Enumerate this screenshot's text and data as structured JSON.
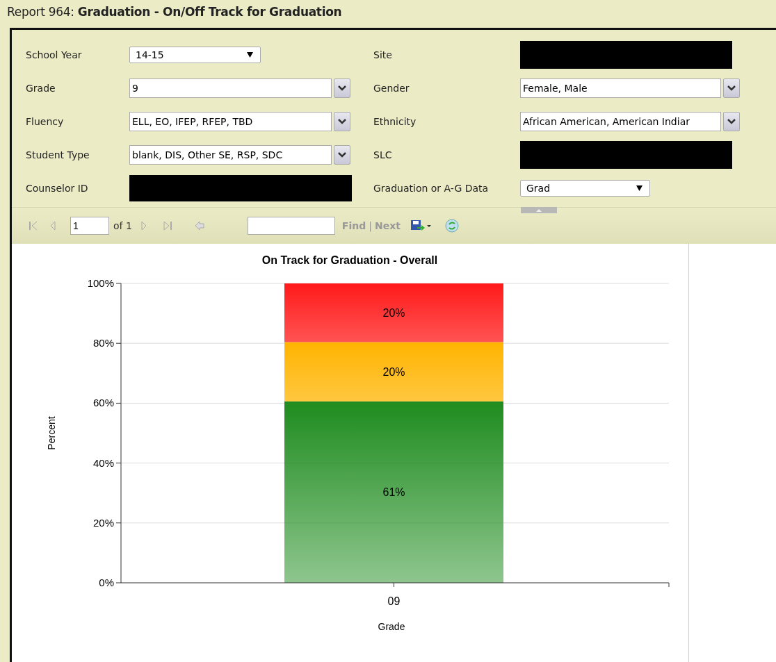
{
  "report_title": {
    "prefix": "Report 964:",
    "name": "Graduation - On/Off Track for Graduation"
  },
  "parameters": {
    "left": [
      {
        "label": "School Year",
        "kind": "select",
        "value": "14-15"
      },
      {
        "label": "Grade",
        "kind": "multiselect",
        "value": "9"
      },
      {
        "label": "Fluency",
        "kind": "multiselect",
        "value": "ELL, EO, IFEP, RFEP, TBD"
      },
      {
        "label": "Student Type",
        "kind": "multiselect",
        "value": "blank, DIS, Other SE, RSP, SDC"
      },
      {
        "label": "Counselor ID",
        "kind": "redacted"
      }
    ],
    "right": [
      {
        "label": "Site",
        "kind": "redacted"
      },
      {
        "label": "Gender",
        "kind": "multiselect",
        "value": "Female, Male"
      },
      {
        "label": "Ethnicity",
        "kind": "multiselect",
        "value": "African American, American Indiar"
      },
      {
        "label": "SLC",
        "kind": "redacted"
      },
      {
        "label": "Graduation or A-G Data",
        "kind": "select",
        "value": "Grad"
      }
    ]
  },
  "toolbar": {
    "page": "1",
    "of": "of 1",
    "find": "Find",
    "separator": "|",
    "next": "Next"
  },
  "chart": {
    "chart_data": {
      "type": "bar",
      "title": "On Track for Graduation - Overall",
      "xlabel": "Grade",
      "ylabel": "Percent",
      "categories": [
        "09"
      ],
      "stacked": true,
      "ylim": [
        0,
        100
      ],
      "yticks": [
        {
          "value": 0,
          "label": "0%"
        },
        {
          "value": 20,
          "label": "20%"
        },
        {
          "value": 40,
          "label": "40%"
        },
        {
          "value": 60,
          "label": "60%"
        },
        {
          "value": 80,
          "label": "80%"
        },
        {
          "value": 100,
          "label": "100%"
        }
      ],
      "grid": true,
      "value_labels": [
        "61%",
        "20%",
        "20%"
      ],
      "series": [
        {
          "color": "#1e8c1e",
          "values": [
            60.6
          ]
        },
        {
          "color": "#ffb400",
          "values": [
            19.8
          ]
        },
        {
          "color": "#ff1a1a",
          "values": [
            19.6
          ]
        }
      ]
    }
  }
}
